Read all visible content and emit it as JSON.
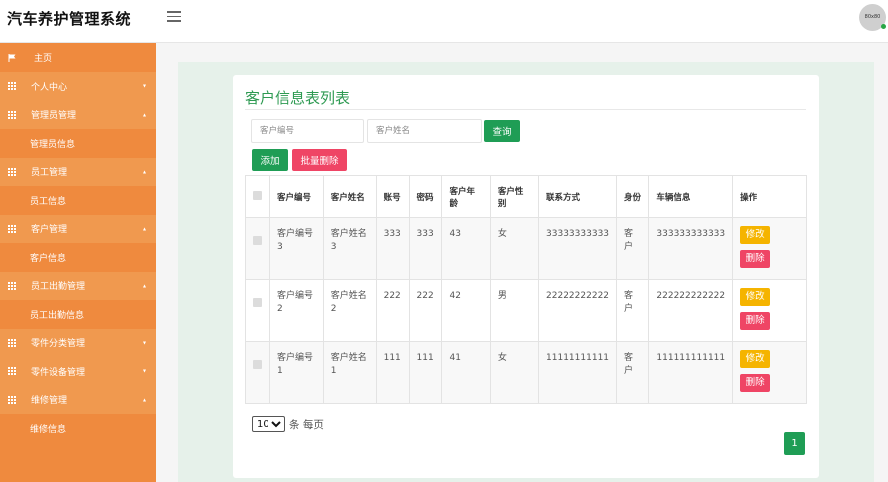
{
  "header": {
    "app_title": "汽车养护管理系统",
    "avatar_text": "80x80"
  },
  "sidebar": {
    "home": "主页",
    "items": [
      {
        "label": "个人中心",
        "type": "parent",
        "caret": "▾"
      },
      {
        "label": "管理员管理",
        "type": "parent",
        "caret": "▴"
      },
      {
        "label": "管理员信息",
        "type": "child"
      },
      {
        "label": "员工管理",
        "type": "parent",
        "caret": "▴"
      },
      {
        "label": "员工信息",
        "type": "child"
      },
      {
        "label": "客户管理",
        "type": "parent",
        "caret": "▴"
      },
      {
        "label": "客户信息",
        "type": "child"
      },
      {
        "label": "员工出勤管理",
        "type": "parent",
        "caret": "▴"
      },
      {
        "label": "员工出勤信息",
        "type": "child"
      },
      {
        "label": "零件分类管理",
        "type": "parent",
        "caret": "▾"
      },
      {
        "label": "零件设备管理",
        "type": "parent",
        "caret": "▾"
      },
      {
        "label": "维修管理",
        "type": "parent",
        "caret": "▴"
      },
      {
        "label": "维修信息",
        "type": "child"
      }
    ]
  },
  "main": {
    "title": "客户信息表列表",
    "search": {
      "customer_no_placeholder": "客户编号",
      "customer_name_placeholder": "客户姓名",
      "query_label": "查询"
    },
    "actions": {
      "add_label": "添加",
      "batch_delete_label": "批量删除"
    },
    "table": {
      "headers": [
        "客户编号",
        "客户姓名",
        "账号",
        "密码",
        "客户年龄",
        "客户性别",
        "联系方式",
        "身份",
        "车辆信息",
        "操作"
      ],
      "rows": [
        {
          "no": "客户编号3",
          "name": "客户姓名3",
          "account": "333",
          "password": "333",
          "age": "43",
          "gender": "女",
          "phone": "33333333333",
          "role": "客户",
          "vehicle": "333333333333"
        },
        {
          "no": "客户编号2",
          "name": "客户姓名2",
          "account": "222",
          "password": "222",
          "age": "42",
          "gender": "男",
          "phone": "22222222222",
          "role": "客户",
          "vehicle": "222222222222"
        },
        {
          "no": "客户编号1",
          "name": "客户姓名1",
          "account": "111",
          "password": "111",
          "age": "41",
          "gender": "女",
          "phone": "11111111111",
          "role": "客户",
          "vehicle": "111111111111"
        }
      ],
      "edit_label": "修改",
      "delete_label": "删除"
    },
    "pagination": {
      "page_size": "10",
      "page_size_suffix": "条 每页",
      "current_page": "1"
    }
  },
  "colors": {
    "sidebar": "#ef8a3e",
    "accent_green": "#1f9d55",
    "danger": "#ef4565",
    "warning": "#f5b400",
    "title_green": "#2e9a52"
  }
}
